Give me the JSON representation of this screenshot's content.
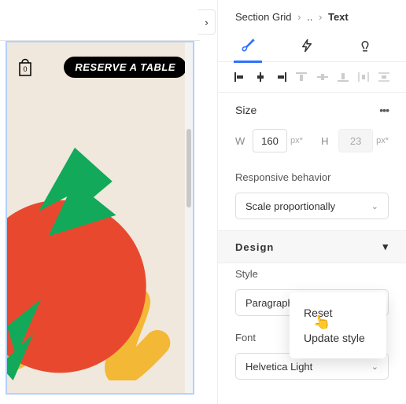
{
  "cart_count": "0",
  "reserve_text": "RESERVE A TABLE",
  "breadcrumbs": {
    "root": "Section Grid",
    "sep1": "›",
    "mid": "..",
    "sep2": "›",
    "current": "Text"
  },
  "tabs": {
    "style_icon": "brush-icon",
    "actions_icon": "lightning-icon",
    "ideas_icon": "lightbulb-icon"
  },
  "align_icons": [
    "align-left-icon",
    "align-center-icon",
    "align-right-icon",
    "text-align-left-icon",
    "text-align-center-icon",
    "text-align-right-icon",
    "justify-top-icon",
    "distribute-icon"
  ],
  "size": {
    "title": "Size",
    "w_label": "W",
    "w_value": "160",
    "w_unit": "px*",
    "h_label": "H",
    "h_value": "23",
    "h_unit": "px*"
  },
  "responsive": {
    "label": "Responsive behavior",
    "value": "Scale proportionally"
  },
  "design_title": "Design",
  "style": {
    "label": "Style",
    "value": "Paragraph"
  },
  "font": {
    "label": "Font",
    "value": "Helvetica Light"
  },
  "popover": {
    "reset": "Reset",
    "update": "Update style"
  }
}
